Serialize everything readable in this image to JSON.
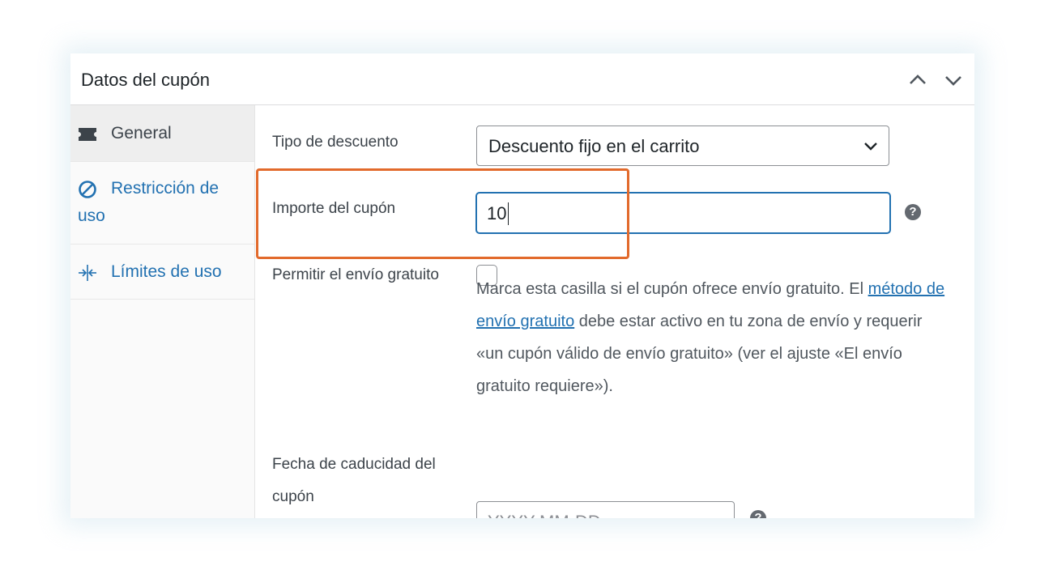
{
  "panel": {
    "title": "Datos del cupón",
    "collapse_up_icon": "chevron-up-icon",
    "collapse_down_icon": "chevron-down-icon"
  },
  "tabs": [
    {
      "label": "General",
      "icon": "ticket-icon",
      "active": true
    },
    {
      "label": "Restricción de uso",
      "icon": "block-icon",
      "active": false
    },
    {
      "label": "Límites de uso",
      "icon": "arrows-in-icon",
      "active": false
    }
  ],
  "fields": {
    "discount_type": {
      "label": "Tipo de descuento",
      "value": "Descuento fijo en el carrito"
    },
    "coupon_amount": {
      "label": "Importe del cupón",
      "value": "10"
    },
    "free_shipping": {
      "label": "Permitir el envío gratuito",
      "checked": false,
      "description_line1_pre": "Marca esta casilla si el cupón ofrece envío gratuito. El ",
      "description_link1": "método de",
      "description_link2": "envío gratuito",
      "description_line2_post": " debe estar activo en tu zona de envío y requerir",
      "description_line3": "«un cupón válido de envío gratuito» (ver el ajuste «El envío",
      "description_line4": "gratuito requiere»)."
    },
    "expiry_date": {
      "label_line1": "Fecha de caducidad del",
      "label_line2": "cupón",
      "placeholder": "YYYY-MM-DD"
    }
  },
  "help_icon": "?",
  "colors": {
    "link": "#2271b1",
    "highlight": "#e26a2c",
    "focus_border": "#2271b1"
  }
}
